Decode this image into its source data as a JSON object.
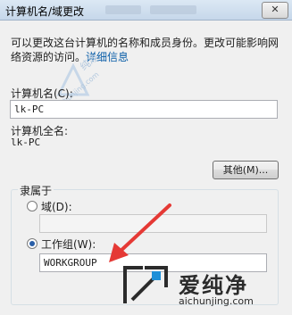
{
  "window": {
    "title": "计算机名/域更改",
    "close_glyph": "✕"
  },
  "description": {
    "text": "可以更改这台计算机的名称和成员身份。更改可能影响网络资源的访问。",
    "link": "详细信息"
  },
  "computer_name": {
    "label": "计算机名(C):",
    "value": "lk-PC"
  },
  "full_name": {
    "label": "计算机全名:",
    "value": "lk-PC"
  },
  "more_button": {
    "label": "其他(M)..."
  },
  "member_of": {
    "label": "隶属于",
    "domain": {
      "label": "域(D):",
      "value": "",
      "selected": false
    },
    "workgroup": {
      "label": "工作组(W):",
      "value": "WORKGROUP",
      "selected": true
    }
  },
  "watermark": {
    "text": "爱纯净",
    "url": "aichunjing.com",
    "faint_text": "纯净",
    "faint_url": "aichunjing.com"
  },
  "colors": {
    "accent": "#0b5ea8",
    "arrow": "#e53935",
    "watermark_text": "#2b2b2b"
  }
}
